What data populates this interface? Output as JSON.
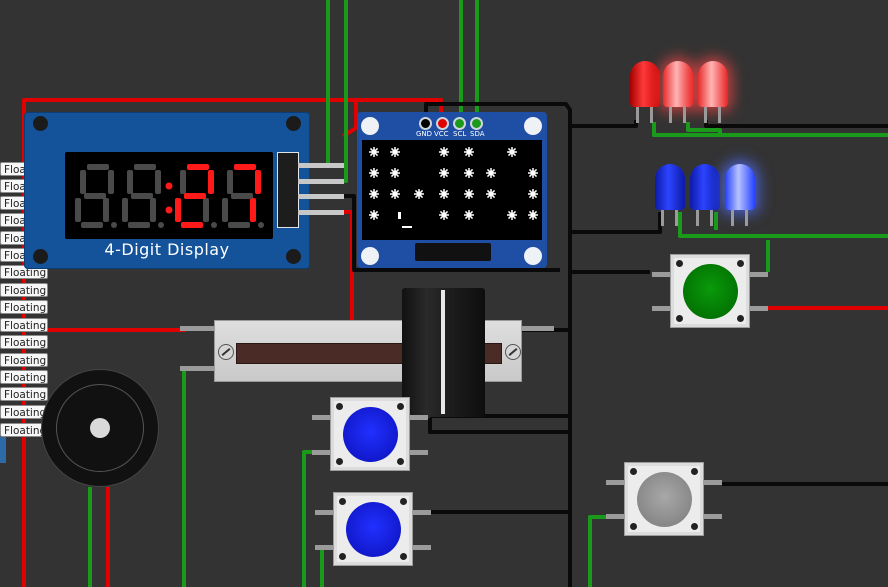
{
  "display_module": {
    "caption": "4-Digit Display",
    "digits": [
      "8",
      "8",
      "2",
      "7"
    ],
    "lit_digits": [
      "",
      "",
      "2",
      "7"
    ],
    "colon_on": true,
    "segment_on_color": "#ff1a1a",
    "segment_off_color": "#4a4a4a",
    "board_color": "#14539a"
  },
  "oled_module": {
    "pin_labels": [
      "GND",
      "VCC",
      "SCL",
      "SDA"
    ],
    "pin_colors": [
      "#000000",
      "#e00000",
      "#1a9a1a",
      "#1a9a1a"
    ],
    "board_color": "#1f4fa4"
  },
  "floating_labels": [
    "Floating",
    "Floating",
    "Floating",
    "Floating",
    "Floating",
    "Floating",
    "Floating",
    "Floating",
    "Floating",
    "Floating",
    "Floating",
    "Floating",
    "Floating",
    "Floating",
    "Floating",
    "Floating"
  ],
  "leds": {
    "red": [
      {
        "state": "off"
      },
      {
        "state": "on"
      },
      {
        "state": "on"
      }
    ],
    "blue": [
      {
        "state": "off"
      },
      {
        "state": "off"
      },
      {
        "state": "on"
      }
    ]
  },
  "buttons": [
    {
      "name": "green-pushbutton",
      "color": "#008a00"
    },
    {
      "name": "blue-pushbutton-1",
      "color": "#0d17e8"
    },
    {
      "name": "blue-pushbutton-2",
      "color": "#0d17e8"
    },
    {
      "name": "gray-pushbutton",
      "color": "#9a9a9a"
    }
  ],
  "wire_colors": {
    "red": "#e00000",
    "green": "#1a9a1a",
    "black": "#0a0a0a",
    "gray": "#9b9b9b"
  },
  "icons": [
    "slide-potentiometer",
    "buzzer",
    "ssd1306-oled",
    "tm1637-4digit-display"
  ]
}
